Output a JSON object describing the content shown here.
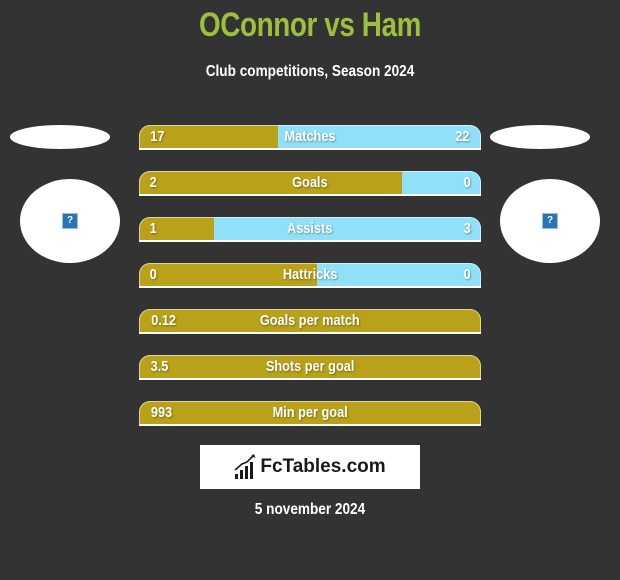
{
  "header": {
    "title": "OConnor vs Ham",
    "subtitle": "Club competitions, Season 2024"
  },
  "players": {
    "left": {
      "logo_icon": "missing-image-icon",
      "logo_glyph": "?"
    },
    "right": {
      "logo_icon": "missing-image-icon",
      "logo_glyph": "?"
    }
  },
  "colors": {
    "left_bar": "#b9a11a",
    "right_bar": "#8fe0f8",
    "title": "#9cbf3c",
    "background": "#333333"
  },
  "stats": [
    {
      "label": "Matches",
      "left": "17",
      "right": "22",
      "left_share": 0.406
    },
    {
      "label": "Goals",
      "left": "2",
      "right": "0",
      "left_share": 0.77
    },
    {
      "label": "Assists",
      "left": "1",
      "right": "3",
      "left_share": 0.22
    },
    {
      "label": "Hattricks",
      "left": "0",
      "right": "0",
      "left_share": 0.52
    },
    {
      "label": "Goals per match",
      "left": "0.12",
      "right": "",
      "left_share": 1.0
    },
    {
      "label": "Shots per goal",
      "left": "3.5",
      "right": "",
      "left_share": 1.0
    },
    {
      "label": "Min per goal",
      "left": "993",
      "right": "",
      "left_share": 1.0
    }
  ],
  "footer": {
    "logo_text": "FcTables.com",
    "logo_icon": "bar-chart-icon",
    "date": "5 november 2024"
  }
}
